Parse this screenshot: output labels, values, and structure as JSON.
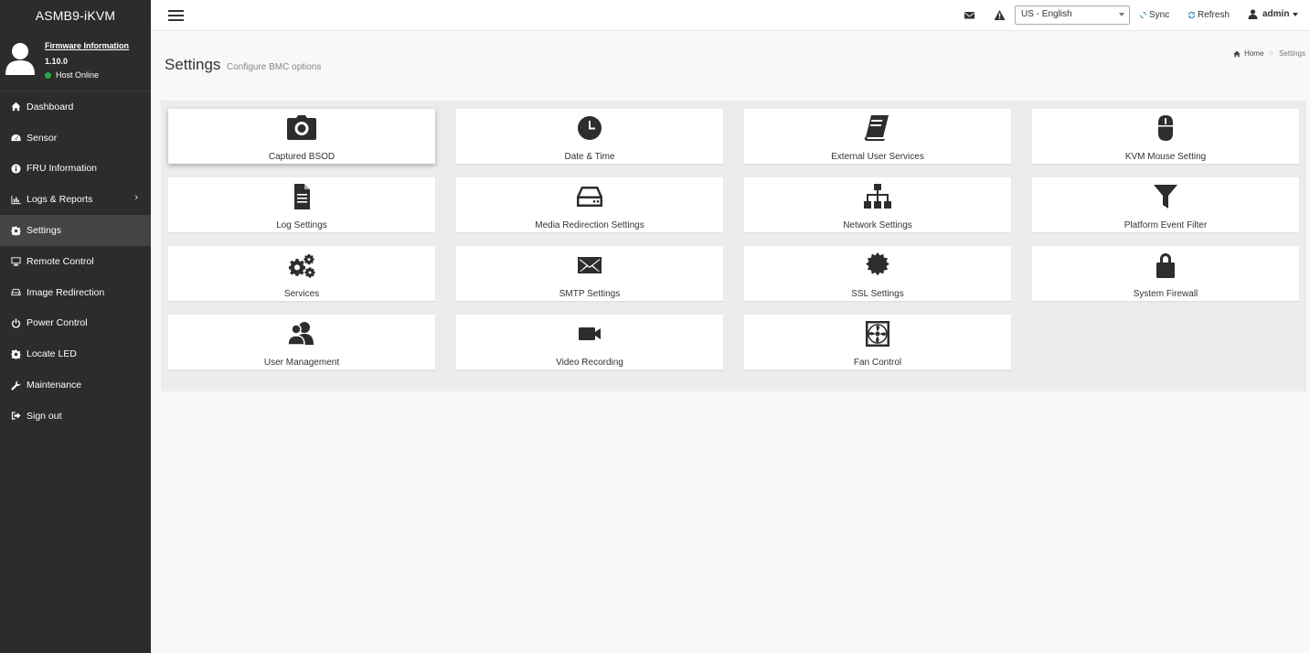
{
  "brand": "ASMB9-iKVM",
  "user_panel": {
    "firmware_label": "Firmware Information",
    "firmware_version": "1.10.0",
    "host_status": "Host Online",
    "status_color": "#28a745"
  },
  "sidebar": {
    "items": [
      {
        "label": "Dashboard",
        "icon": "home-icon"
      },
      {
        "label": "Sensor",
        "icon": "dashboard-icon"
      },
      {
        "label": "FRU Information",
        "icon": "info-icon"
      },
      {
        "label": "Logs & Reports",
        "icon": "bar-chart-icon"
      },
      {
        "label": "Settings",
        "icon": "gear-icon"
      },
      {
        "label": "Remote Control",
        "icon": "monitor-icon"
      },
      {
        "label": "Image Redirection",
        "icon": "drive-icon"
      },
      {
        "label": "Power Control",
        "icon": "power-icon"
      },
      {
        "label": "Locate LED",
        "icon": "gear-icon"
      },
      {
        "label": "Maintenance",
        "icon": "wrench-icon"
      },
      {
        "label": "Sign out",
        "icon": "sign-out-icon"
      }
    ],
    "expand_arrow": "›"
  },
  "topbar": {
    "language": "US - English",
    "sync_label": "Sync",
    "refresh_label": "Refresh",
    "user_label": "admin",
    "accent_color": "#3c8dbc"
  },
  "header": {
    "title": "Settings",
    "subtitle": "Configure BMC options"
  },
  "breadcrumb": {
    "home": "Home",
    "separator": ">",
    "current": "Settings"
  },
  "tiles": [
    {
      "label": "Captured BSOD",
      "icon": "camera-icon"
    },
    {
      "label": "Date & Time",
      "icon": "clock-icon"
    },
    {
      "label": "External User Services",
      "icon": "book-icon"
    },
    {
      "label": "KVM Mouse Setting",
      "icon": "mouse-icon"
    },
    {
      "label": "Log Settings",
      "icon": "document-icon"
    },
    {
      "label": "Media Redirection Settings",
      "icon": "hdd-icon"
    },
    {
      "label": "Network Settings",
      "icon": "sitemap-icon"
    },
    {
      "label": "Platform Event Filter",
      "icon": "filter-icon"
    },
    {
      "label": "Services",
      "icon": "gears-icon"
    },
    {
      "label": "SMTP Settings",
      "icon": "envelope-icon"
    },
    {
      "label": "SSL Settings",
      "icon": "certificate-icon"
    },
    {
      "label": "System Firewall",
      "icon": "lock-icon"
    },
    {
      "label": "User Management",
      "icon": "users-icon"
    },
    {
      "label": "Video Recording",
      "icon": "video-camera-icon"
    },
    {
      "label": "Fan Control",
      "icon": "fan-icon"
    }
  ]
}
